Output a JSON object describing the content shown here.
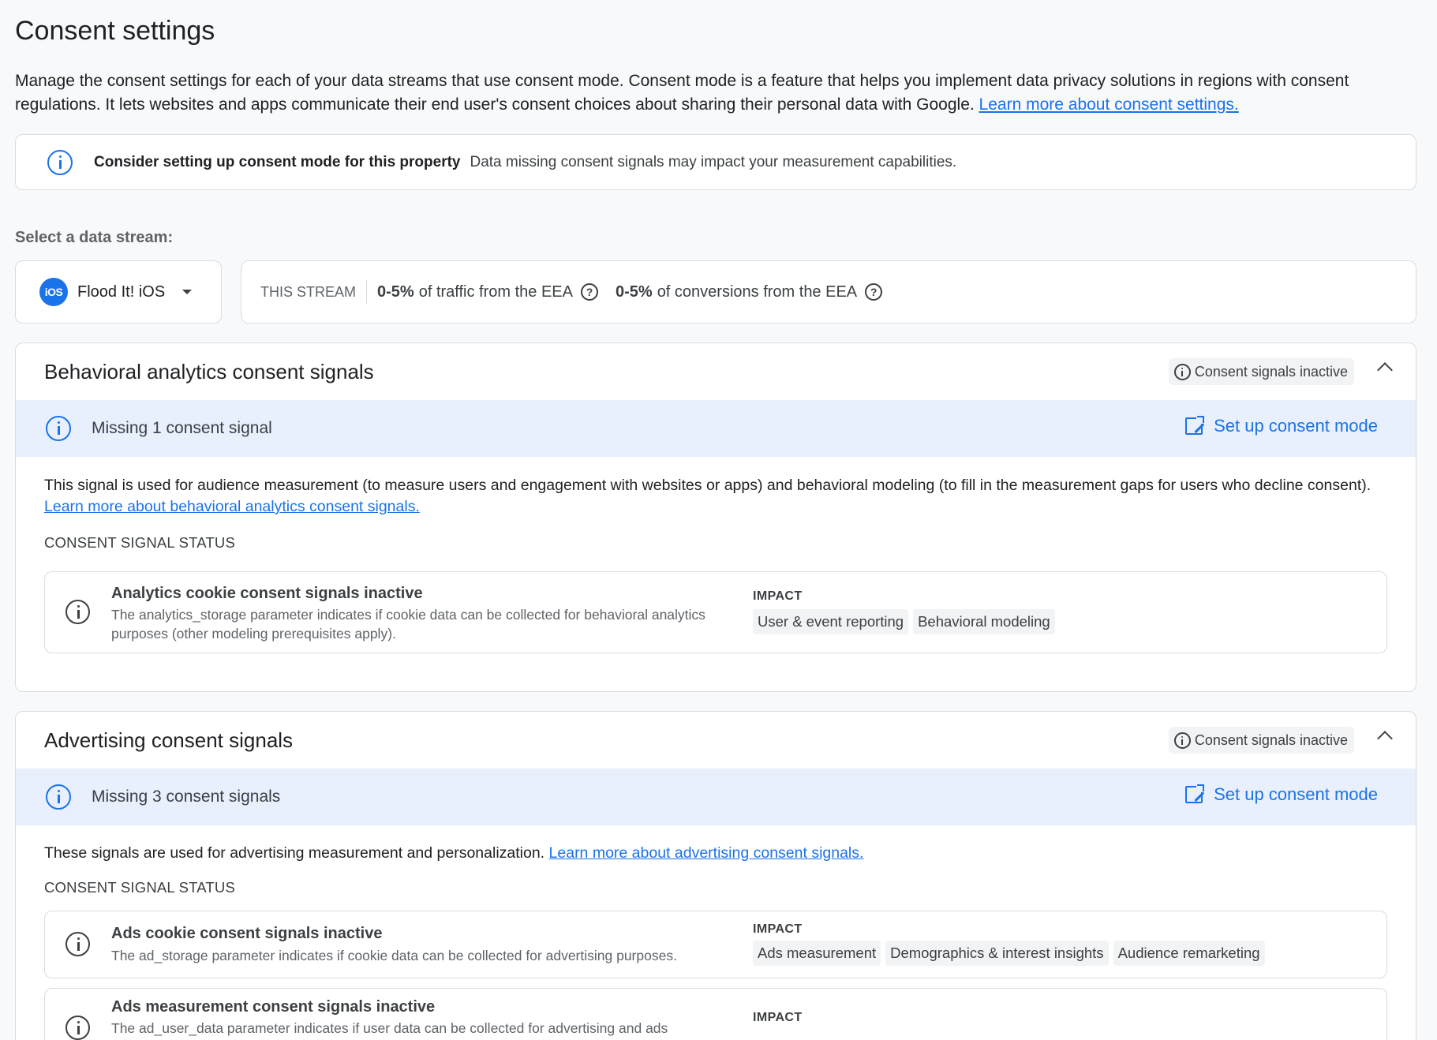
{
  "page": {
    "title": "Consent settings",
    "intro_text": "Manage the consent settings for each of your data streams that use consent mode. Consent mode is a feature that helps you implement data privacy solutions in regions with consent regulations. It lets websites and apps communicate their end user's consent choices about sharing their personal data with Google. ",
    "intro_link": "Learn more about consent settings."
  },
  "notice": {
    "bold": "Consider setting up consent mode for this property",
    "text": "Data missing consent signals may impact your measurement capabilities.",
    "icon": "info-icon"
  },
  "stream": {
    "label": "Select a data stream:",
    "badge": "iOS",
    "name": "Flood It! iOS",
    "stats_label": "THIS STREAM",
    "traffic_value": "0-5%",
    "traffic_text": "of traffic from the EEA",
    "conversions_value": "0-5%",
    "conversions_text": "of conversions from the EEA",
    "help_glyph": "?"
  },
  "behavioral": {
    "title": "Behavioral analytics consent signals",
    "status": "Consent signals inactive",
    "missing": "Missing 1 consent signal",
    "setup": "Set up consent mode",
    "desc": "This signal is used for audience measurement (to measure users and engagement with websites or apps) and behavioral modeling (to fill in the measurement gaps for users who decline consent). ",
    "desc_link": "Learn more about behavioral analytics consent signals.",
    "section_label": "CONSENT SIGNAL STATUS",
    "signals": [
      {
        "title": "Analytics cookie consent signals inactive",
        "desc": "The analytics_storage parameter indicates if cookie data can be collected for behavioral analytics purposes (other modeling prerequisites apply).",
        "impact_label": "IMPACT",
        "chips": [
          "User & event reporting",
          "Behavioral modeling"
        ]
      }
    ]
  },
  "advertising": {
    "title": "Advertising consent signals",
    "status": "Consent signals inactive",
    "missing": "Missing 3 consent signals",
    "setup": "Set up consent mode",
    "desc": "These signals are used for advertising measurement and personalization. ",
    "desc_link": "Learn more about advertising consent signals.",
    "section_label": "CONSENT SIGNAL STATUS",
    "signals": [
      {
        "title": "Ads cookie consent signals inactive",
        "desc": "The ad_storage parameter indicates if cookie data can be collected for advertising purposes.",
        "impact_label": "IMPACT",
        "chips": [
          "Ads measurement",
          "Demographics & interest insights",
          "Audience remarketing"
        ]
      },
      {
        "title": "Ads measurement consent signals inactive",
        "desc": "The ad_user_data parameter indicates if user data can be collected for advertising and ads",
        "impact_label": "IMPACT"
      }
    ]
  },
  "colors": {
    "accent": "#1a73e8",
    "banner_bg": "#e8f0fe",
    "border": "#dadce0"
  }
}
